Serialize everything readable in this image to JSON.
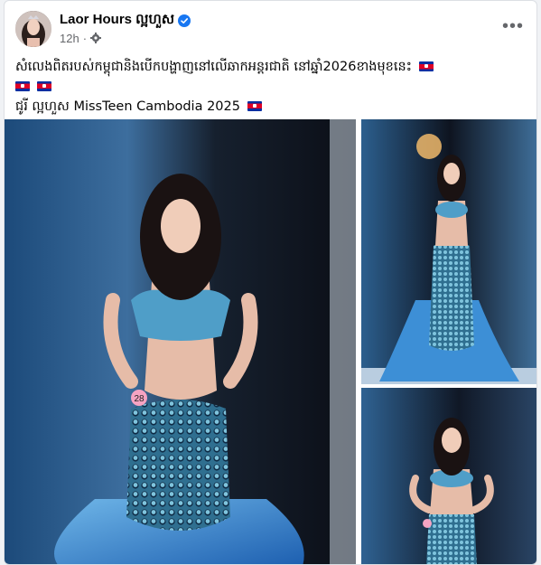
{
  "post": {
    "author": "Laor Hours ល្អហួស",
    "time": "12h",
    "dot": "·",
    "icons": {
      "verified": "verified-badge-icon",
      "audience": "gear-icon",
      "more": "more-options-icon"
    },
    "text_lines": [
      "សំលេងពិតរបស់កម្ពុជានិងបើកបង្ហាញនៅលើឆាកអន្តរជាតិ នៅឆ្នាំ2026ខាងមុខនេះ",
      "",
      "ជូរី ល្អហួស MissTeen Cambodia 2025"
    ],
    "flags_per_line": [
      1,
      2,
      1
    ],
    "photo_badge_number": "28"
  },
  "colors": {
    "accent_blue": "#1877f2",
    "text_primary": "#050505",
    "text_secondary": "#65676b",
    "page_bg": "#f0f2f5"
  }
}
